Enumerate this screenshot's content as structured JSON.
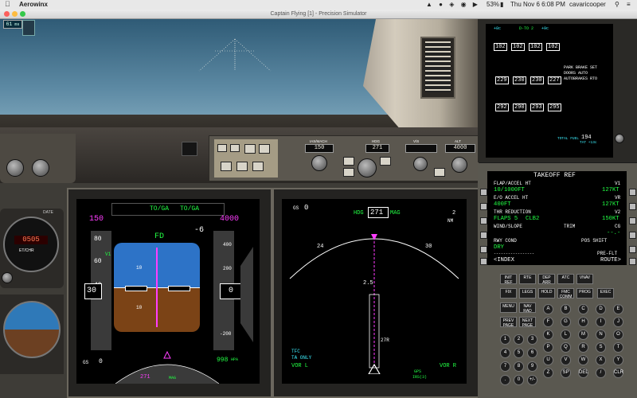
{
  "menubar": {
    "app_name": "Aerowinx",
    "battery": "53%",
    "datetime": "Thu Nov 6  6:08 PM",
    "user": "cavaricooper"
  },
  "window": {
    "title": "Captain Flying [1] - Precision Simulator"
  },
  "fps_badge": "61",
  "mcp": {
    "ias_label": "IAS/MACH",
    "ias_value": "150",
    "hdg_label": "HDG",
    "hdg_value": "271",
    "vs_label": "V/S",
    "alt_label": "ALT",
    "alt_value": "4000"
  },
  "pfd": {
    "fma_1": "TO/GA",
    "fma_2": "TO/GA",
    "speed_bug": "150",
    "selected_alt": "4000",
    "fd": "FD",
    "speed_v1": "V1",
    "speed_80": "80",
    "speed_60": "60",
    "speed_40": "40",
    "speed_30": "30",
    "alt_readout": "0",
    "baro": "998",
    "baro_unit": "HPA",
    "gs_label": "GS",
    "gs_value": "0",
    "hdg_readout": "271",
    "hdg_ref": "MAG",
    "minus6": "-6",
    "alt_400": "400",
    "alt_200": "200",
    "alt_m200": "-200",
    "pitch_10": "10",
    "pitch_m10": "10"
  },
  "nd": {
    "gs_label": "GS",
    "gs_value": "0",
    "hdg_label": "HDG",
    "hdg_value": "271",
    "mag": "MAG",
    "range_1": "2",
    "range_2": "NM",
    "rwy_label": "27R",
    "dist_label": "2.5",
    "heading_24": "24",
    "heading_30": "30",
    "tfc": "TFC",
    "ta_only": "TA ONLY",
    "vor_l": "VOR L",
    "vor_r": "VOR R",
    "gps": "GPS",
    "irs": "IRS(3)"
  },
  "eicas": {
    "eng": [
      "102",
      "102",
      "102",
      "102"
    ],
    "egt": [
      "229",
      "230",
      "230",
      "227"
    ],
    "n2": [
      "292",
      "290",
      "293",
      "295"
    ],
    "status_1": "PARK BRAKE SET",
    "status_2": "DOORS AUTO",
    "status_3": "AUTOBRAKES RTO",
    "total_fuel_label": "TOTAL FUEL",
    "total_fuel": "194",
    "tat": "TAT +13c",
    "eng_label": "D-TO 2",
    "temp_1": "+8c",
    "temp_2": "+9c"
  },
  "cdu": {
    "title": "TAKEOFF REF",
    "l1_label": "FLAP/ACCEL HT",
    "l1_value": "10/1000FT",
    "r1_label": "V1",
    "r1_value": "127KT",
    "l2_label": "E/O ACCEL HT",
    "l2_value": "400FT",
    "r2_label": "VR",
    "r2_value": "127KT",
    "l3_label": "THR REDUCTION",
    "l3_value": "FLAPS 5",
    "l3_value2": "CLB2",
    "r3_label": "V2",
    "r3_value": "150KT",
    "l4_label": "WIND/SLOPE",
    "l4_label2": "TRIM",
    "r4_label": "CG",
    "r4_value": "--.-",
    "l5_label": "RWY COND",
    "l5_value": "DRY",
    "r5_label": "POS SHIFT",
    "sep": "-----------------",
    "l6_value": "<INDEX",
    "r6_label": "PRE-FLT",
    "r6_value": "ROUTE>",
    "keys_row1": [
      "INIT REF",
      "RTE",
      "DEP ARR",
      "ATC",
      "VNAV"
    ],
    "keys_row2": [
      "FIX",
      "LEGS",
      "HOLD",
      "FMC COMM",
      "PROG",
      "EXEC"
    ],
    "keys_row3": [
      "MENU",
      "NAV RAD"
    ],
    "keys_row4": [
      "PREV PAGE",
      "NEXT PAGE"
    ],
    "alpha": [
      "A",
      "B",
      "C",
      "D",
      "E",
      "F",
      "G",
      "H",
      "I",
      "J",
      "K",
      "L",
      "M",
      "N",
      "O",
      "P",
      "Q",
      "R",
      "S",
      "T",
      "U",
      "V",
      "W",
      "X",
      "Y",
      "Z",
      "SP",
      "DEL",
      "/",
      "CLR"
    ],
    "nums": [
      "1",
      "2",
      "3",
      "4",
      "5",
      "6",
      "7",
      "8",
      "9",
      ".",
      "0",
      "+/-"
    ]
  },
  "clock": {
    "value": "0505",
    "label": "ET/CHR",
    "date_label": "DATE"
  }
}
